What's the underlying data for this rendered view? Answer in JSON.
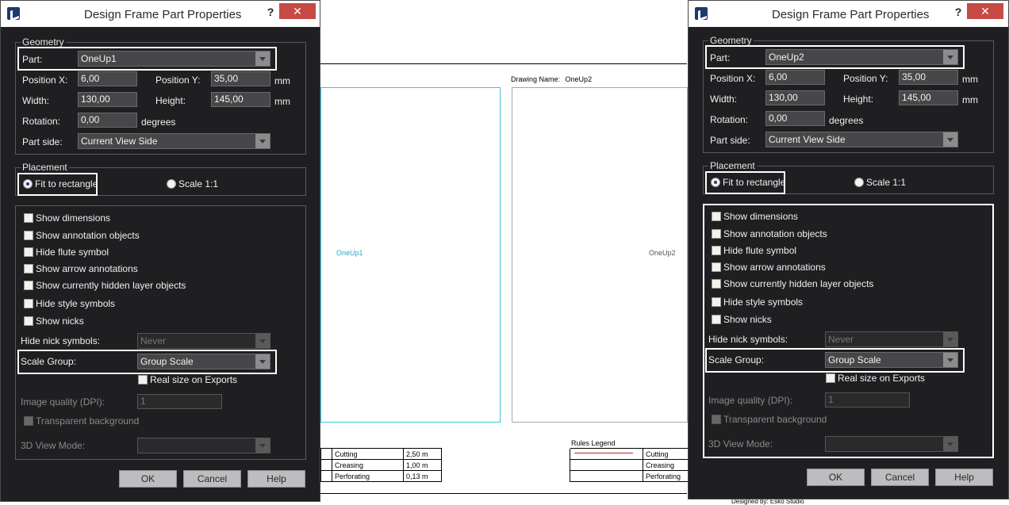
{
  "canvas": {
    "drawing_name_label": "Drawing Name:",
    "drawing_name_value": "OneUp2",
    "part_labels": [
      "OneUp1",
      "OneUp2"
    ],
    "legend_title": "Rules Legend",
    "legend_rows": [
      {
        "name": "Cutting",
        "value": "2,50 m"
      },
      {
        "name": "Creasing",
        "value": "1,00 m"
      },
      {
        "name": "Perforating",
        "value": "0,13 m"
      }
    ],
    "legend_rows_right": [
      "Cutting",
      "Creasing",
      "Perforating"
    ],
    "bottom_note": "Designed by: Esko Studio"
  },
  "dialogs": [
    {
      "title": "Design Frame Part Properties",
      "help": "?",
      "close": "✕",
      "geometry": {
        "legend": "Geometry",
        "part_label": "Part:",
        "part_value": "OneUp1",
        "pos_x_label": "Position X:",
        "pos_x": "6,00",
        "pos_y_label": "Position Y:",
        "pos_y": "35,00",
        "mm1": "mm",
        "width_label": "Width:",
        "width": "130,00",
        "height_label": "Height:",
        "height": "145,00",
        "mm2": "mm",
        "rotation_label": "Rotation:",
        "rotation": "0,00",
        "degrees": "degrees",
        "part_side_label": "Part side:",
        "part_side": "Current View Side"
      },
      "placement": {
        "legend": "Placement",
        "fit": "Fit to rectangle",
        "scale": "Scale 1:1"
      },
      "options": {
        "show_dimensions": "Show dimensions",
        "show_annotation_objects": "Show annotation objects",
        "hide_flute_symbol": "Hide flute symbol",
        "show_arrow_annotations": "Show arrow annotations",
        "show_hidden_layer_objects": "Show currently hidden layer objects",
        "hide_style_symbols": "Hide style symbols",
        "show_nicks": "Show nicks",
        "hide_nick_symbols_label": "Hide nick symbols:",
        "hide_nick_symbols": "Never",
        "scale_group_label": "Scale Group:",
        "scale_group": "Group Scale",
        "real_size": "Real size on Exports",
        "image_quality_label": "Image quality (DPI):",
        "image_quality": "1",
        "transparent_bg": "Transparent background",
        "view_3d_label": "3D View Mode:",
        "view_3d": ""
      },
      "buttons": {
        "ok": "OK",
        "cancel": "Cancel",
        "help": "Help"
      }
    },
    {
      "title": "Design Frame Part Properties",
      "help": "?",
      "close": "✕",
      "geometry": {
        "legend": "Geometry",
        "part_label": "Part:",
        "part_value": "OneUp2",
        "pos_x_label": "Position X:",
        "pos_x": "6,00",
        "pos_y_label": "Position Y:",
        "pos_y": "35,00",
        "mm1": "mm",
        "width_label": "Width:",
        "width": "130,00",
        "height_label": "Height:",
        "height": "145,00",
        "mm2": "mm",
        "rotation_label": "Rotation:",
        "rotation": "0,00",
        "degrees": "degrees",
        "part_side_label": "Part side:",
        "part_side": "Current View Side"
      },
      "placement": {
        "legend": "Placement",
        "fit": "Fit to rectangle",
        "scale": "Scale 1:1"
      },
      "options": {
        "show_dimensions": "Show dimensions",
        "show_annotation_objects": "Show annotation objects",
        "hide_flute_symbol": "Hide flute symbol",
        "show_arrow_annotations": "Show arrow annotations",
        "show_hidden_layer_objects": "Show currently hidden layer objects",
        "hide_style_symbols": "Hide style symbols",
        "show_nicks": "Show nicks",
        "hide_nick_symbols_label": "Hide nick symbols:",
        "hide_nick_symbols": "Never",
        "scale_group_label": "Scale Group:",
        "scale_group": "Group Scale",
        "real_size": "Real size on Exports",
        "image_quality_label": "Image quality (DPI):",
        "image_quality": "1",
        "transparent_bg": "Transparent background",
        "view_3d_label": "3D View Mode:",
        "view_3d": ""
      },
      "buttons": {
        "ok": "OK",
        "cancel": "Cancel",
        "help": "Help"
      }
    }
  ],
  "colors": {
    "dialog_bg": "#1f1f22",
    "close_button": "#c74a45",
    "frame_selected": "#3ec8d8",
    "highlight_box": "#ffffff"
  }
}
